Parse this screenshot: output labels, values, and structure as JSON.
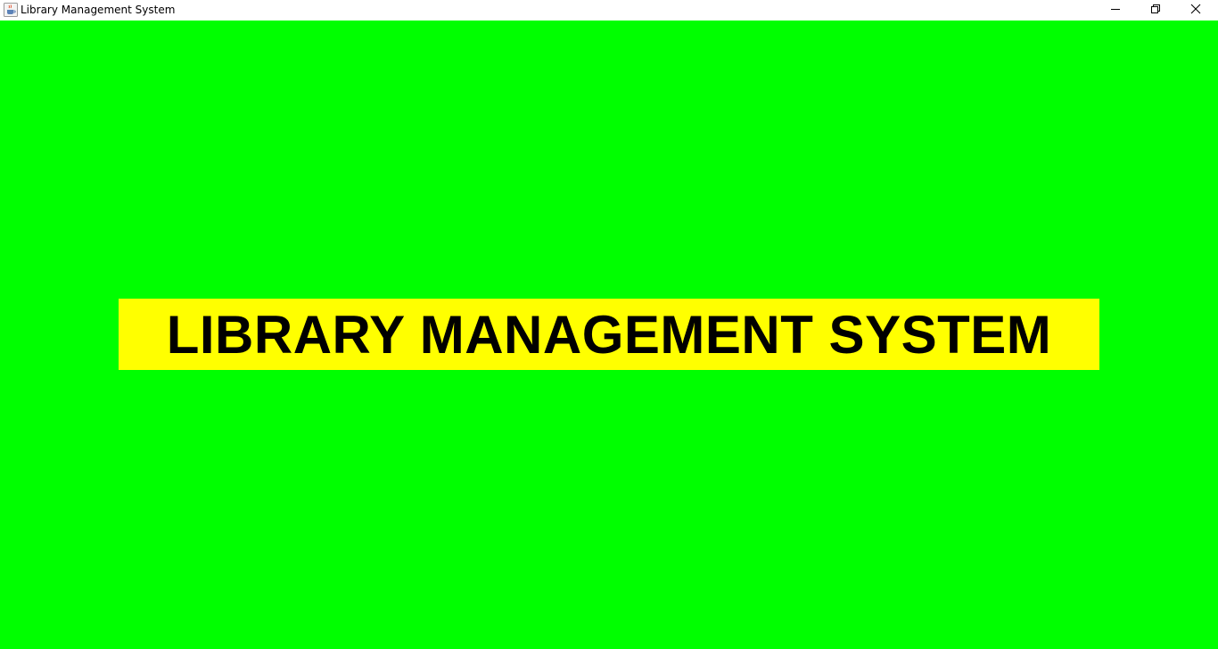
{
  "window": {
    "title": "Library Management System",
    "icon": "java-coffee-icon",
    "controls": {
      "minimize": "minimize-icon",
      "restore": "restore-icon",
      "close": "close-icon"
    }
  },
  "main": {
    "background_color": "#00ff00",
    "banner": {
      "text": "LIBRARY MANAGEMENT SYSTEM",
      "background_color": "#ffff00",
      "text_color": "#000000"
    }
  }
}
